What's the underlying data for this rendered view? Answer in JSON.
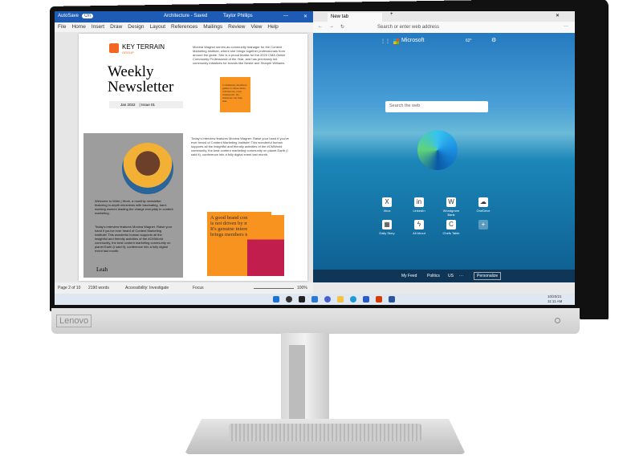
{
  "brand": "Lenovo",
  "word": {
    "autosave_label": "AutoSave",
    "autosave_state": "On",
    "doc_title": "Architecture - Saved",
    "user": "Taylor Phillips",
    "menu": [
      "File",
      "Home",
      "Insert",
      "Draw",
      "Design",
      "Layout",
      "References",
      "Mailings",
      "Review",
      "View",
      "Help"
    ],
    "newsletter": {
      "company": "KEY TERRAIN",
      "company_sub": "GROUP",
      "title_line1": "Weekly",
      "title_line2": "Newsletter",
      "date": "Jan 2022",
      "issue": "Issue 01",
      "intro": "Welcome to Write | Work, a monthly newsletter featuring in-depth interviews with fascinating, hard-working women leading the charge everyday in content marketing.",
      "feature": "Today's interview features Monina Wagner. Raise your hand if you've ever heard of Content Marketing Institute! This wonderful human supports all the insightful and friendly activities of the #CMWorld community, the best content marketing community on planet Earth (I said it), conference into a fully digital event last month.",
      "signature": "Leah",
      "bio": "Monina Wagner serves as community manager for the Content Marketing Institute, where she brings together professionals from around the globe. She is a proud finalist for the 2020 CMA Online Community Professional of the Year, and has previously led community initiatives for brands like Nestle and Sharpie Williams.",
      "quote_small": "Community members gather to share ideas, collaborate, even brainstorm. No marketer can fake that.",
      "quote_large": "A good brand community is not driven by marketing. It's genuine interest that brings members together."
    },
    "status": {
      "page": "Page 2 of 10",
      "words": "2190 words",
      "accessibility": "Accessibility: Investigate",
      "focus": "Focus",
      "zoom": "100%"
    }
  },
  "edge": {
    "tab": "New tab",
    "address_placeholder": "Search or enter web address",
    "brand": "Microsoft",
    "weather": "62°",
    "search_placeholder": "Search the web",
    "tiles": [
      {
        "label": "Xbox",
        "glyph": "X"
      },
      {
        "label": "LinkedIn",
        "glyph": "in"
      },
      {
        "label": "Woodgrove Bank",
        "glyph": "W"
      },
      {
        "label": "OneDrive",
        "glyph": "☁"
      },
      {
        "label": "Daily Story",
        "glyph": "▦"
      },
      {
        "label": "All About",
        "glyph": "ϟ"
      },
      {
        "label": "Chefs Table",
        "glyph": "C"
      },
      {
        "label": "",
        "glyph": "+"
      }
    ],
    "feed": [
      "My Feed",
      "Politics",
      "US",
      "···"
    ],
    "personalize": "Personalize"
  },
  "taskbar": {
    "date": "10/20/21",
    "time": "11:11 AM"
  }
}
